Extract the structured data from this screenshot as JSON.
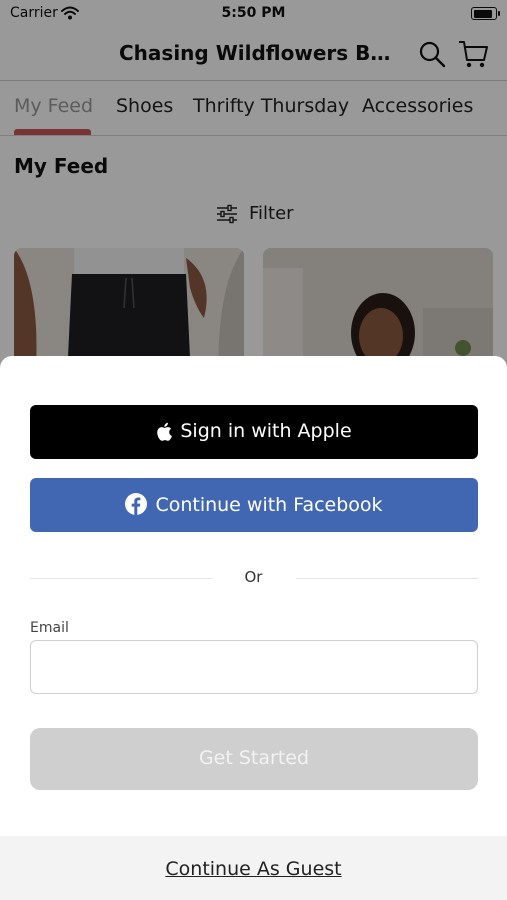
{
  "status_bar": {
    "carrier": "Carrier",
    "time": "5:50 PM",
    "battery_level": 1.0
  },
  "nav": {
    "title": "Chasing Wildflowers Bo...",
    "search_icon": "search-icon",
    "cart_icon": "cart-icon"
  },
  "tabs": {
    "items": [
      {
        "label": "My Feed",
        "active": true
      },
      {
        "label": "Shoes",
        "active": false
      },
      {
        "label": "Thrifty Thursday",
        "active": false
      },
      {
        "label": "Accessories",
        "active": false
      }
    ]
  },
  "feed": {
    "title": "My Feed",
    "filter_label": "Filter",
    "filter_icon": "sliders-icon"
  },
  "sheet": {
    "apple_label": "Sign in with Apple",
    "facebook_label": "Continue with Facebook",
    "or_label": "Or",
    "email_label": "Email",
    "email_value": "",
    "get_started_label": "Get Started",
    "guest_label": "Continue As Guest"
  },
  "colors": {
    "facebook_blue": "#4267b2",
    "apple_black": "#000000",
    "disabled_gray": "#cfcfcf",
    "overlay": "rgba(0,0,0,0.40)",
    "accent_tab": "#cc5555"
  }
}
